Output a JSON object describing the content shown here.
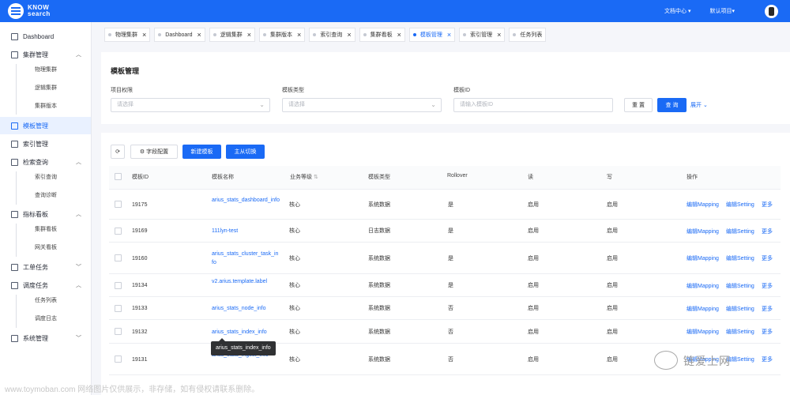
{
  "header": {
    "logo_line1": "KNOW",
    "logo_line2": "search",
    "docs": "文档中心",
    "project": "默认项目"
  },
  "sidebar": {
    "items": [
      {
        "label": "Dashboard"
      },
      {
        "label": "集群管理"
      },
      {
        "label": "模板管理"
      },
      {
        "label": "索引管理"
      },
      {
        "label": "检索查询"
      },
      {
        "label": "指标看板"
      },
      {
        "label": "工单任务"
      },
      {
        "label": "调度任务"
      },
      {
        "label": "系统管理"
      }
    ],
    "sub": {
      "cluster": [
        "物理集群",
        "逻辑集群",
        "集群版本"
      ],
      "search": [
        "索引查询",
        "查询诊断"
      ],
      "metrics": [
        "集群看板",
        "网关看板"
      ],
      "schedule": [
        "任务列表",
        "调度日志"
      ]
    }
  },
  "tabs": [
    "物理集群",
    "Dashboard",
    "逻辑集群",
    "集群版本",
    "索引查询",
    "集群看板",
    "模板管理",
    "索引管理",
    "任务列表"
  ],
  "filter": {
    "title": "模板管理",
    "project_label": "项目权限",
    "project_placeholder": "请选择",
    "type_label": "模板类型",
    "type_placeholder": "请选择",
    "id_label": "模板ID",
    "id_placeholder": "请输入模板ID",
    "reset": "重 置",
    "query": "查 询",
    "expand": "展开"
  },
  "toolbar": {
    "field_config": "字段配置",
    "new_template": "新建模板",
    "master_switch": "主从切换"
  },
  "table": {
    "headers": [
      "模板ID",
      "模板名称",
      "业务等级",
      "模板类型",
      "Rollover",
      "读",
      "写",
      "操作"
    ],
    "rows": [
      {
        "id": "19175",
        "name": "arius_stats_dashboard_info",
        "level": "核心",
        "type": "系统数据",
        "rollover": "是",
        "read": "启用",
        "write": "启用"
      },
      {
        "id": "19169",
        "name": "111lyn-test",
        "level": "核心",
        "type": "日志数据",
        "rollover": "是",
        "read": "启用",
        "write": "启用"
      },
      {
        "id": "19160",
        "name": "arius_stats_cluster_task_info",
        "level": "核心",
        "type": "系统数据",
        "rollover": "是",
        "read": "启用",
        "write": "启用"
      },
      {
        "id": "19134",
        "name": "v2.arius.template.label",
        "level": "核心",
        "type": "系统数据",
        "rollover": "是",
        "read": "启用",
        "write": "启用"
      },
      {
        "id": "19133",
        "name": "arius_stats_node_info",
        "level": "核心",
        "type": "系统数据",
        "rollover": "否",
        "read": "启用",
        "write": "启用"
      },
      {
        "id": "19132",
        "name": "arius_stats_index_info",
        "level": "核心",
        "type": "系统数据",
        "rollover": "否",
        "read": "启用",
        "write": "启用"
      },
      {
        "id": "19131",
        "name": "arius_stats_ingest_info",
        "level": "核心",
        "type": "系统数据",
        "rollover": "否",
        "read": "启用",
        "write": "启用"
      }
    ],
    "ops": [
      "编辑Mapping",
      "编辑Setting",
      "更多"
    ]
  },
  "tooltip": "arius_stats_index_info",
  "watermark": {
    "account": "链爱上网",
    "footer": "www.toymoban.com 网络图片仅供展示，非存储，如有侵权请联系删除。"
  },
  "colors": {
    "primary": "#1a6af5",
    "bg": "#f5f6fa"
  }
}
